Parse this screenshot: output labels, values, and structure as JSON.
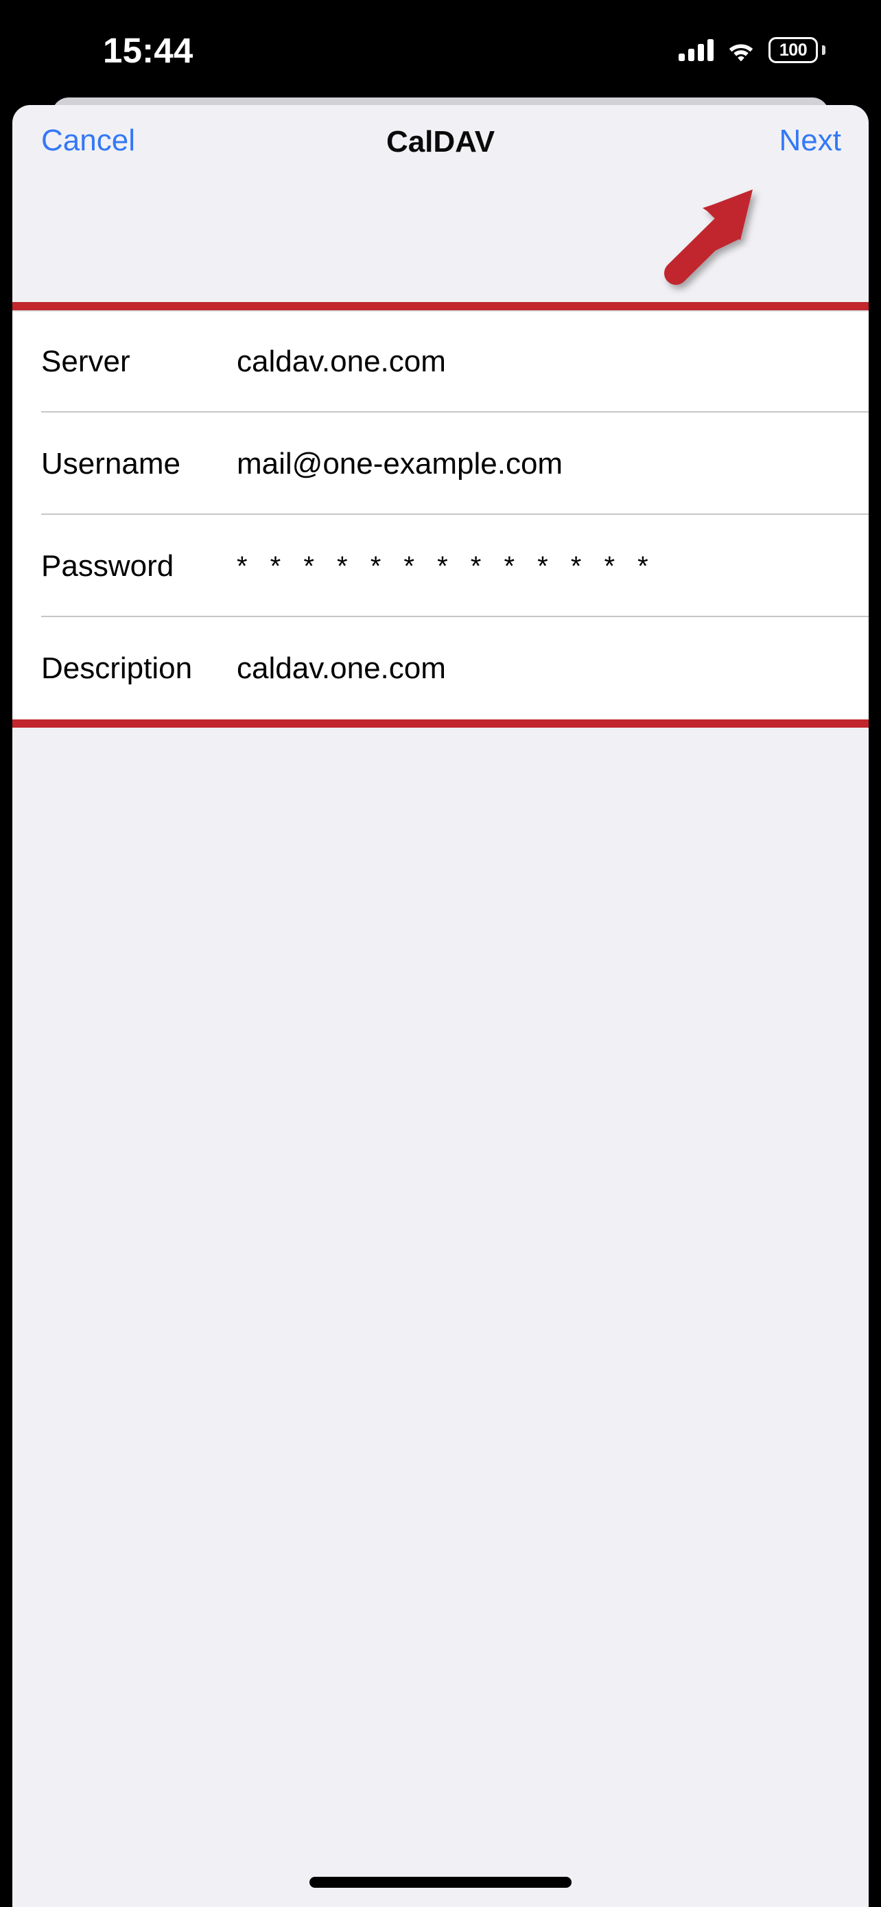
{
  "status_bar": {
    "time": "15:44",
    "battery_percent": "100",
    "cellular_icon": "cellular-bars-icon",
    "wifi_icon": "wifi-icon",
    "battery_icon": "battery-full-icon"
  },
  "navbar": {
    "cancel_label": "Cancel",
    "title": "CalDAV",
    "next_label": "Next"
  },
  "form": {
    "rows": [
      {
        "label": "Server",
        "value": "caldav.one.com",
        "masked": false
      },
      {
        "label": "Username",
        "value": "mail@one-example.com",
        "masked": false
      },
      {
        "label": "Password",
        "value": "* * * * * * * * * * * * *",
        "masked": true
      },
      {
        "label": "Description",
        "value": "caldav.one.com",
        "masked": false
      }
    ]
  },
  "annotations": {
    "highlight_box_color": "#C1272D",
    "arrow_color": "#C1272D",
    "arrow_icon": "arrow-up-right-icon",
    "arrow_target": "Next"
  },
  "colors": {
    "accent_blue": "#3478F6",
    "sheet_bg": "#F1F1F5",
    "sheet_behind_bg": "#D1D1D6",
    "card_bg": "#FFFFFF",
    "separator": "#C6C6C8",
    "status_bar_bg": "#000000"
  },
  "home_indicator": {
    "name": "home-indicator"
  }
}
